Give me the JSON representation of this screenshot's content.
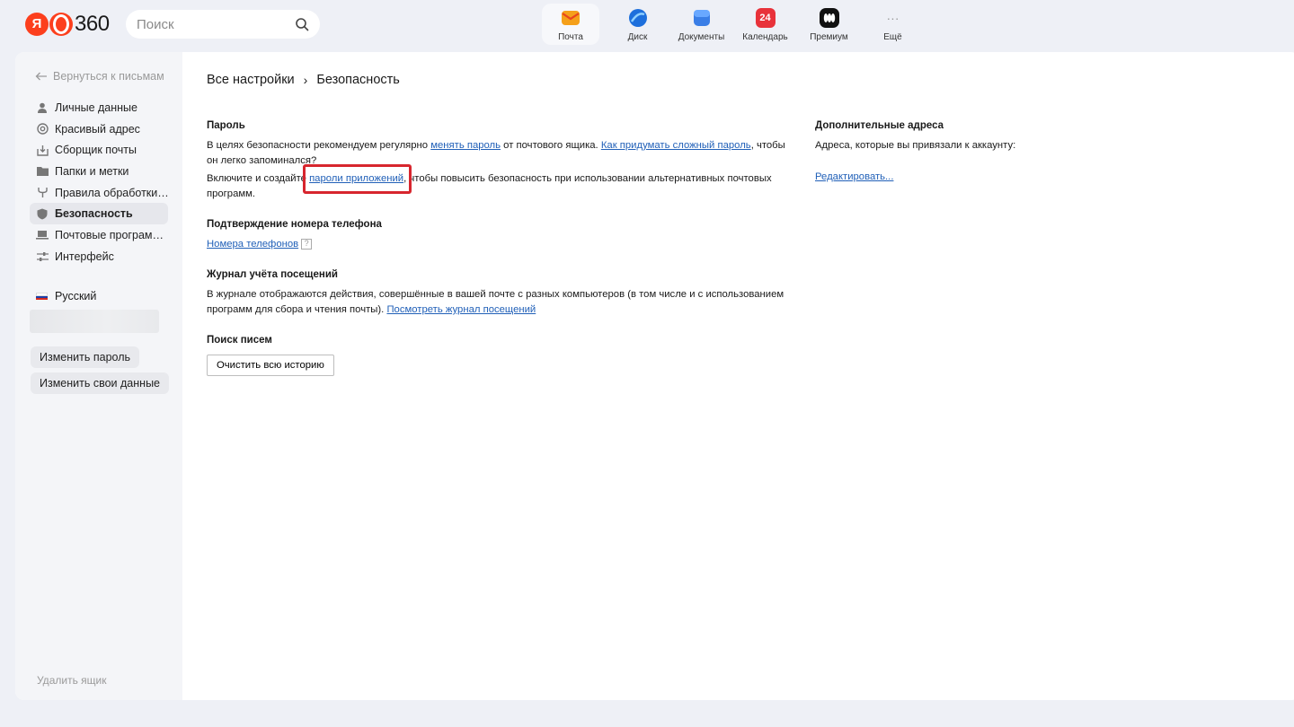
{
  "header": {
    "logo_ya": "Я",
    "logo_num": "360",
    "search_placeholder": "Поиск",
    "services": [
      {
        "label": "Почта",
        "icon": "mail-icon",
        "color": "#f5a01a"
      },
      {
        "label": "Диск",
        "icon": "disk-icon",
        "color": "#1d6fdc"
      },
      {
        "label": "Документы",
        "icon": "documents-icon",
        "color": "#3a7ee6"
      },
      {
        "label": "Календарь",
        "icon": "calendar-icon",
        "color": "#e8323a",
        "badge": "24"
      },
      {
        "label": "Премиум",
        "icon": "premium-icon",
        "color": "#111111"
      },
      {
        "label": "Ещё",
        "icon": "more-icon",
        "glyph": "···"
      }
    ]
  },
  "sidebar": {
    "back": "Вернуться к письмам",
    "items": [
      {
        "label": "Личные данные",
        "icon": "person-icon"
      },
      {
        "label": "Красивый адрес",
        "icon": "at-icon"
      },
      {
        "label": "Сборщик почты",
        "icon": "inbox-download-icon"
      },
      {
        "label": "Папки и метки",
        "icon": "folder-icon"
      },
      {
        "label": "Правила обработки…",
        "icon": "rules-icon"
      },
      {
        "label": "Безопасность",
        "icon": "shield-icon",
        "selected": true
      },
      {
        "label": "Почтовые програм…",
        "icon": "laptop-icon"
      },
      {
        "label": "Интерфейс",
        "icon": "sliders-icon"
      }
    ],
    "language": "Русский",
    "change_password": "Изменить пароль",
    "change_data": "Изменить свои данные",
    "delete_box": "Удалить ящик"
  },
  "breadcrumb": {
    "root": "Все настройки",
    "separator": "›",
    "current": "Безопасность"
  },
  "password": {
    "title": "Пароль",
    "p1_before": "В целях безопасности рекомендуем регулярно ",
    "p1_link1": "менять пароль",
    "p1_middle": " от почтового ящика. ",
    "p1_link2": "Как придумать сложный пароль",
    "p1_after": ", чтобы он легко запоминался?",
    "p2_before": "Включите и создайте ",
    "p2_link": "пароли приложений",
    "p2_after": ", чтобы повысить безопасность при использовании альтернативных почтовых программ."
  },
  "phone": {
    "title": "Подтверждение номера телефона",
    "link": "Номера телефонов",
    "help": "?"
  },
  "journal": {
    "title": "Журнал учёта посещений",
    "text": "В журнале отображаются действия, совершённые в вашей почте с разных компьютеров (в том числе и с использованием программ для сбора и чтения почты). ",
    "link": "Посмотреть журнал посещений"
  },
  "search_history": {
    "title": "Поиск писем",
    "button": "Очистить всю историю"
  },
  "additional": {
    "title": "Дополнительные адреса",
    "text": "Адреса, которые вы привязали к аккаунту:",
    "edit": "Редактировать..."
  },
  "colors": {
    "accent_link": "#2160b8",
    "highlight": "#d7262e",
    "logo_red": "#fc3f1d"
  }
}
